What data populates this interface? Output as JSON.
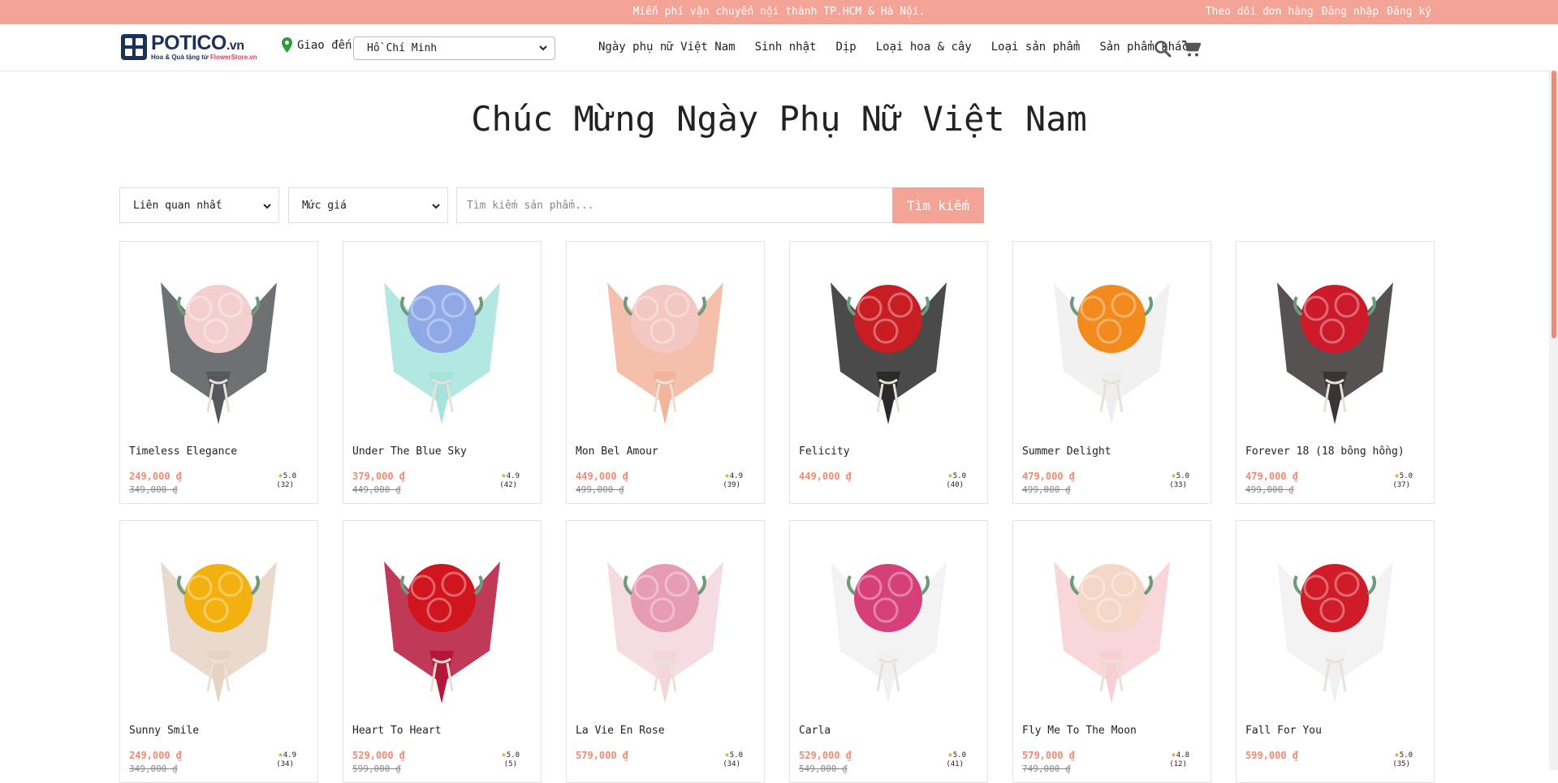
{
  "topbar": {
    "promo": "Miễn phí vận chuyển nội thành TP.HCM & Hà Nội.",
    "links": [
      "Theo dõi đơn hàng",
      "Đăng nhập",
      "Đăng ký"
    ]
  },
  "header": {
    "logo_name": "POTICO",
    "logo_tld": ".vn",
    "logo_tagline": "Hoa & Quà tặng từ ",
    "logo_tagline_brand": "FlowerStore.vn",
    "deliver_label": "Giao đến",
    "city": "Hồ Chí Minh",
    "nav": [
      "Ngày phụ nữ Việt Nam",
      "Sinh nhật",
      "Dịp",
      "Loại hoa & cây",
      "Loại sản phẩm",
      "Sản phẩm khác"
    ]
  },
  "page_title": "Chúc Mừng Ngày Phụ Nữ Việt Nam",
  "filters": {
    "sort": "Liên quan nhất",
    "price": "Mức giá",
    "search_placeholder": "Tìm kiếm sản phẩm...",
    "search_button": "Tìm kiếm"
  },
  "colors": {
    "accent": "#f4a397",
    "price": "#f08a74",
    "brand": "#1c3158"
  },
  "products": [
    {
      "name": "Timeless Elegance",
      "price": "249,000 ₫",
      "old_price": "349,000 ₫",
      "rating": "5.0",
      "reviews": "(32)",
      "wrap": "#55585c",
      "flower": "#f4cfd0"
    },
    {
      "name": "Under The Blue Sky",
      "price": "379,000 ₫",
      "old_price": "449,000 ₫",
      "rating": "4.9",
      "reviews": "(42)",
      "wrap": "#a6e3dc",
      "flower": "#8fa9e6"
    },
    {
      "name": "Mon Bel Amour",
      "price": "449,000 ₫",
      "old_price": "499,000 ₫",
      "rating": "4.9",
      "reviews": "(39)",
      "wrap": "#f2b49c",
      "flower": "#f3c7c2"
    },
    {
      "name": "Felicity",
      "price": "449,000 ₫",
      "old_price": "",
      "rating": "5.0",
      "reviews": "(40)",
      "wrap": "#2a2a2a",
      "flower": "#c91d24"
    },
    {
      "name": "Summer Delight",
      "price": "479,000 ₫",
      "old_price": "499,000 ₫",
      "rating": "5.0",
      "reviews": "(33)",
      "wrap": "#eeeeee",
      "flower": "#f28a1e"
    },
    {
      "name": "Forever 18 (18 bông hồng)",
      "price": "479,000 ₫",
      "old_price": "499,000 ₫",
      "rating": "5.0",
      "reviews": "(37)",
      "wrap": "#3a3434",
      "flower": "#cc1a2a"
    },
    {
      "name": "Sunny Smile",
      "price": "249,000 ₫",
      "old_price": "349,000 ₫",
      "rating": "4.9",
      "reviews": "(34)",
      "wrap": "#e6d3c4",
      "flower": "#f2b10f"
    },
    {
      "name": "Heart To Heart",
      "price": "529,000 ₫",
      "old_price": "599,000 ₫",
      "rating": "5.0",
      "reviews": "(5)",
      "wrap": "#b5173a",
      "flower": "#d0151f"
    },
    {
      "name": "La Vie En Rose",
      "price": "579,000 ₫",
      "old_price": "",
      "rating": "5.0",
      "reviews": "(34)",
      "wrap": "#f3d6dd",
      "flower": "#e79cb6"
    },
    {
      "name": "Carla",
      "price": "529,000 ₫",
      "old_price": "549,000 ₫",
      "rating": "5.0",
      "reviews": "(41)",
      "wrap": "#f1f1f1",
      "flower": "#d6407a"
    },
    {
      "name": "Fly Me To The Moon",
      "price": "579,000 ₫",
      "old_price": "749,000 ₫",
      "rating": "4.8",
      "reviews": "(12)",
      "wrap": "#f7cfd4",
      "flower": "#f5d7c8"
    },
    {
      "name": "Fall For You",
      "price": "599,000 ₫",
      "old_price": "",
      "rating": "5.0",
      "reviews": "(35)",
      "wrap": "#f1f1f1",
      "flower": "#cf1c28"
    }
  ]
}
